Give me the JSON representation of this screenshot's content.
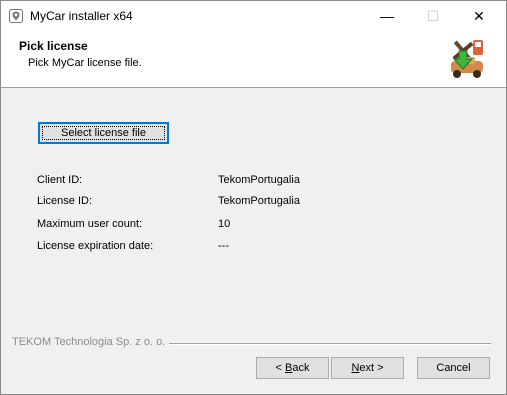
{
  "window": {
    "title": "MyCar installer x64",
    "minimize_glyph": "—",
    "maximize_glyph": "☐",
    "close_glyph": "✕"
  },
  "header": {
    "title": "Pick license",
    "subtitle": "Pick MyCar license file.",
    "logo_icon": "installer-logo-icon"
  },
  "main": {
    "select_button_label": "Select license file",
    "info": [
      {
        "label": "Client ID:",
        "value": "TekomPortugalia"
      },
      {
        "label": "License ID:",
        "value": "TekomPortugalia"
      },
      {
        "label": "Maximum user count:",
        "value": "10"
      },
      {
        "label": "License expiration date:",
        "value": "---"
      }
    ]
  },
  "footer": {
    "brand": "TEKOM Technologia Sp. z o. o.",
    "back": {
      "prefix": "< ",
      "mnemonic": "B",
      "rest": "ack"
    },
    "next": {
      "mnemonic": "N",
      "rest": "ext >"
    },
    "cancel": "Cancel"
  },
  "colors": {
    "accent": "#0078d7",
    "dialog_bg": "#f0f0f0",
    "header_bg": "#ffffff",
    "brand_text": "#8c8c8c"
  }
}
